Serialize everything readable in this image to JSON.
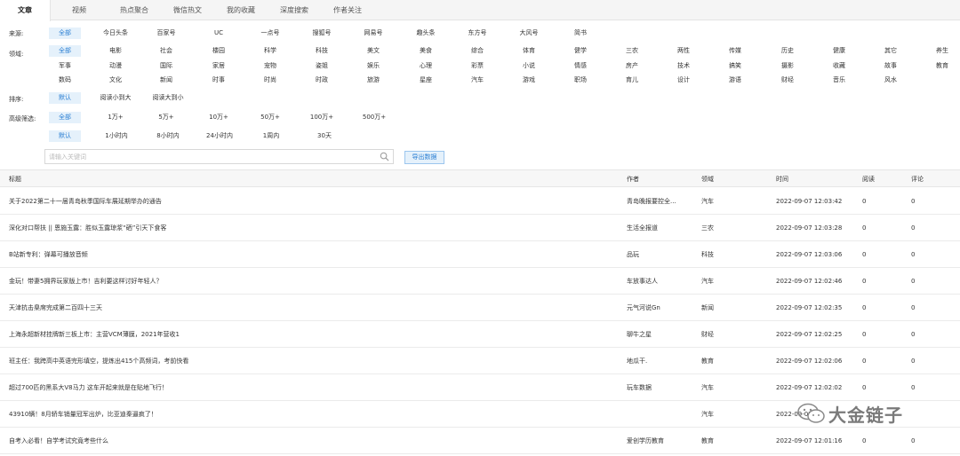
{
  "tabs": [
    "文章",
    "视频",
    "热点聚合",
    "微信热文",
    "我的收藏",
    "深度搜索",
    "作者关注"
  ],
  "filters": {
    "source_label": "来源:",
    "sources": [
      "全部",
      "今日头条",
      "百家号",
      "UC",
      "一点号",
      "搜狐号",
      "网易号",
      "趣头条",
      "东方号",
      "大风号",
      "简书"
    ],
    "field_label": "领域:",
    "fields_row1": [
      "全部",
      "电影",
      "社会",
      "楼园",
      "科学",
      "科技",
      "美文",
      "美食",
      "综合",
      "体育",
      "健学",
      "三农",
      "两性",
      "传媒",
      "历史",
      "健康",
      "其它",
      "养生"
    ],
    "fields_row2": [
      "军事",
      "动漫",
      "国际",
      "家居",
      "宠物",
      "姿姐",
      "娱乐",
      "心理",
      "彩票",
      "小说",
      "情感",
      "房产",
      "技术",
      "搞笑",
      "摄影",
      "收藏",
      "故事",
      "教育"
    ],
    "fields_row3": [
      "数码",
      "文化",
      "新闻",
      "时事",
      "时尚",
      "时政",
      "旅游",
      "星座",
      "汽车",
      "游戏",
      "职场",
      "育儿",
      "设计",
      "游语",
      "财经",
      "音乐",
      "风水"
    ],
    "sort_label": "排序:",
    "sorts": [
      "默认",
      "阅读小到大",
      "阅读大到小"
    ],
    "advanced_label": "高级筛选:",
    "reads": [
      "全部",
      "1万+",
      "5万+",
      "10万+",
      "50万+",
      "100万+",
      "500万+"
    ],
    "times": [
      "默认",
      "1小时内",
      "8小时内",
      "24小时内",
      "1周内",
      "30天"
    ]
  },
  "search": {
    "placeholder": "请输入关键词",
    "export_label": "导出数据"
  },
  "table": {
    "headers": [
      "标题",
      "作者",
      "领域",
      "时间",
      "阅读",
      "评论"
    ],
    "rows": [
      [
        "关于2022第二十一届青岛秋季国际车展延期举办的通告",
        "青岛晚报要控全...",
        "汽车",
        "2022-09-07 12:03:42",
        "0",
        "0"
      ],
      [
        "深化对口帮扶 || 恩施玉露：胜似玉露琼浆“硒”引天下食客",
        "生活全报道",
        "三农",
        "2022-09-07 12:03:28",
        "0",
        "0"
      ],
      [
        "B站新专利：弹幕可播放音频",
        "品玩",
        "科技",
        "2022-09-07 12:03:06",
        "0",
        "0"
      ],
      [
        "金玩！带妻5拥界玩家版上市！吉利要这样讨好年轻人？",
        "车放事达人",
        "汽车",
        "2022-09-07 12:02:46",
        "0",
        "0"
      ],
      [
        "天津抗击臬席完成第二百四十三天",
        "元气河说Gn",
        "新闻",
        "2022-09-07 12:02:35",
        "0",
        "0"
      ],
      [
        "上海永超新材挂牌新三板上市：主营VCM薄膜，2021年营收1",
        "聊牛之星",
        "财经",
        "2022-09-07 12:02:25",
        "0",
        "0"
      ],
      [
        "班主任：我跨高中英语完形填空，提炼出415个高频词，考前快看",
        "地瓜干.",
        "教育",
        "2022-09-07 12:02:06",
        "0",
        "0"
      ],
      [
        "超过700匹的黑系大V8马力 这车开起来就是在贴地飞行！",
        "玩车数据",
        "汽车",
        "2022-09-07 12:02:02",
        "0",
        "0"
      ],
      [
        "43910辆！8月轿车销量冠军出炉，比亚迪秦逼疯了！",
        "",
        "汽车",
        "2022-09-07 1",
        "",
        ""
      ],
      [
        "自考入必看！自学考试究竟考些什么",
        "爱创学历教育",
        "教育",
        "2022-09-07 12:01:16",
        "0",
        "0"
      ]
    ]
  },
  "watermark": {
    "text": "大金链子",
    "icon": "wechat-icon"
  },
  "colors": {
    "accent": "#2b7fd3",
    "active_bg": "#e5f1fb"
  }
}
